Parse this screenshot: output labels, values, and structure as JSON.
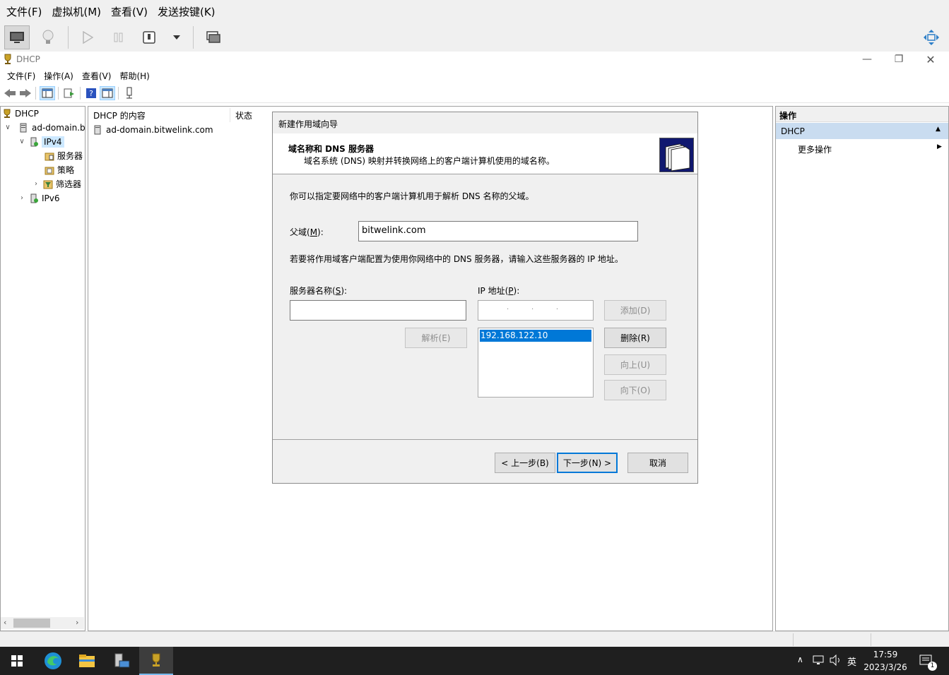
{
  "vm_menu": [
    "文件(F)",
    "虚拟机(M)",
    "查看(V)",
    "发送按键(K)"
  ],
  "window": {
    "title": "DHCP"
  },
  "app_menu": [
    "文件(F)",
    "操作(A)",
    "查看(V)",
    "帮助(H)"
  ],
  "tree": {
    "root": "DHCP",
    "server": "ad-domain.b",
    "ipv4": "IPv4",
    "servers": "服务器",
    "policies": "策略",
    "filters": "筛选器",
    "ipv6": "IPv6"
  },
  "content": {
    "col_name": "DHCP 的内容",
    "col_status": "状态",
    "row_server": "ad-domain.bitwelink.com"
  },
  "actions": {
    "header": "操作",
    "section": "DHCP",
    "more": "更多操作"
  },
  "dialog": {
    "title": "新建作用域向导",
    "heading": "域名称和 DNS 服务器",
    "subheading": "域名系统 (DNS) 映射并转换网络上的客户端计算机使用的域名称。",
    "intro": "你可以指定要网络中的客户端计算机用于解析 DNS 名称的父域。",
    "parent_label": "父域(",
    "parent_key": "M",
    "parent_label_end": "):",
    "parent_value": "bitwelink.com",
    "dns_intro": "若要将作用域客户端配置为使用你网络中的 DNS 服务器，请输入这些服务器的 IP 地址。",
    "server_label": "服务器名称(",
    "server_key": "S",
    "server_label_end": "):",
    "ip_label": "IP 地址(",
    "ip_key": "P",
    "ip_label_end": "):",
    "server_value": "",
    "ip_dots": ".          .          .",
    "ip_list": [
      "192.168.122.10"
    ],
    "btn_add": "添加(D)",
    "btn_resolve": "解析(E)",
    "btn_delete": "删除(R)",
    "btn_up": "向上(U)",
    "btn_down": "向下(O)",
    "btn_back": "< 上一步(B)",
    "btn_next": "下一步(N) >",
    "btn_cancel": "取消"
  },
  "taskbar": {
    "ime": "英",
    "time": "17:59",
    "date": "2023/3/26",
    "notif_count": "1"
  },
  "colors": {
    "accent": "#0078d7",
    "selection": "#cce8ff",
    "taskbar": "#1f1f1f"
  }
}
